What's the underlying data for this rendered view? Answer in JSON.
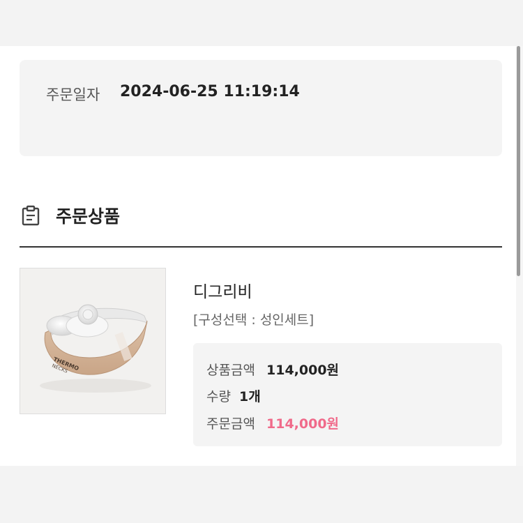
{
  "order": {
    "date_label": "주문일자",
    "date_value": "2024-06-25 11:19:14"
  },
  "section": {
    "title": "주문상품",
    "icon": "clipboard-icon"
  },
  "product": {
    "name": "디그리비",
    "option": "[구성선택 : 성인세트]",
    "image_text": [
      "THERMO",
      "NECKS"
    ],
    "price_label": "상품금액",
    "price_value": "114,000원",
    "qty_label": "수량",
    "qty_value": "1개",
    "order_label": "주문금액",
    "order_value": "114,000원"
  },
  "colors": {
    "accent_pink": "#f06a8a",
    "card_bg": "#f4f4f4"
  }
}
